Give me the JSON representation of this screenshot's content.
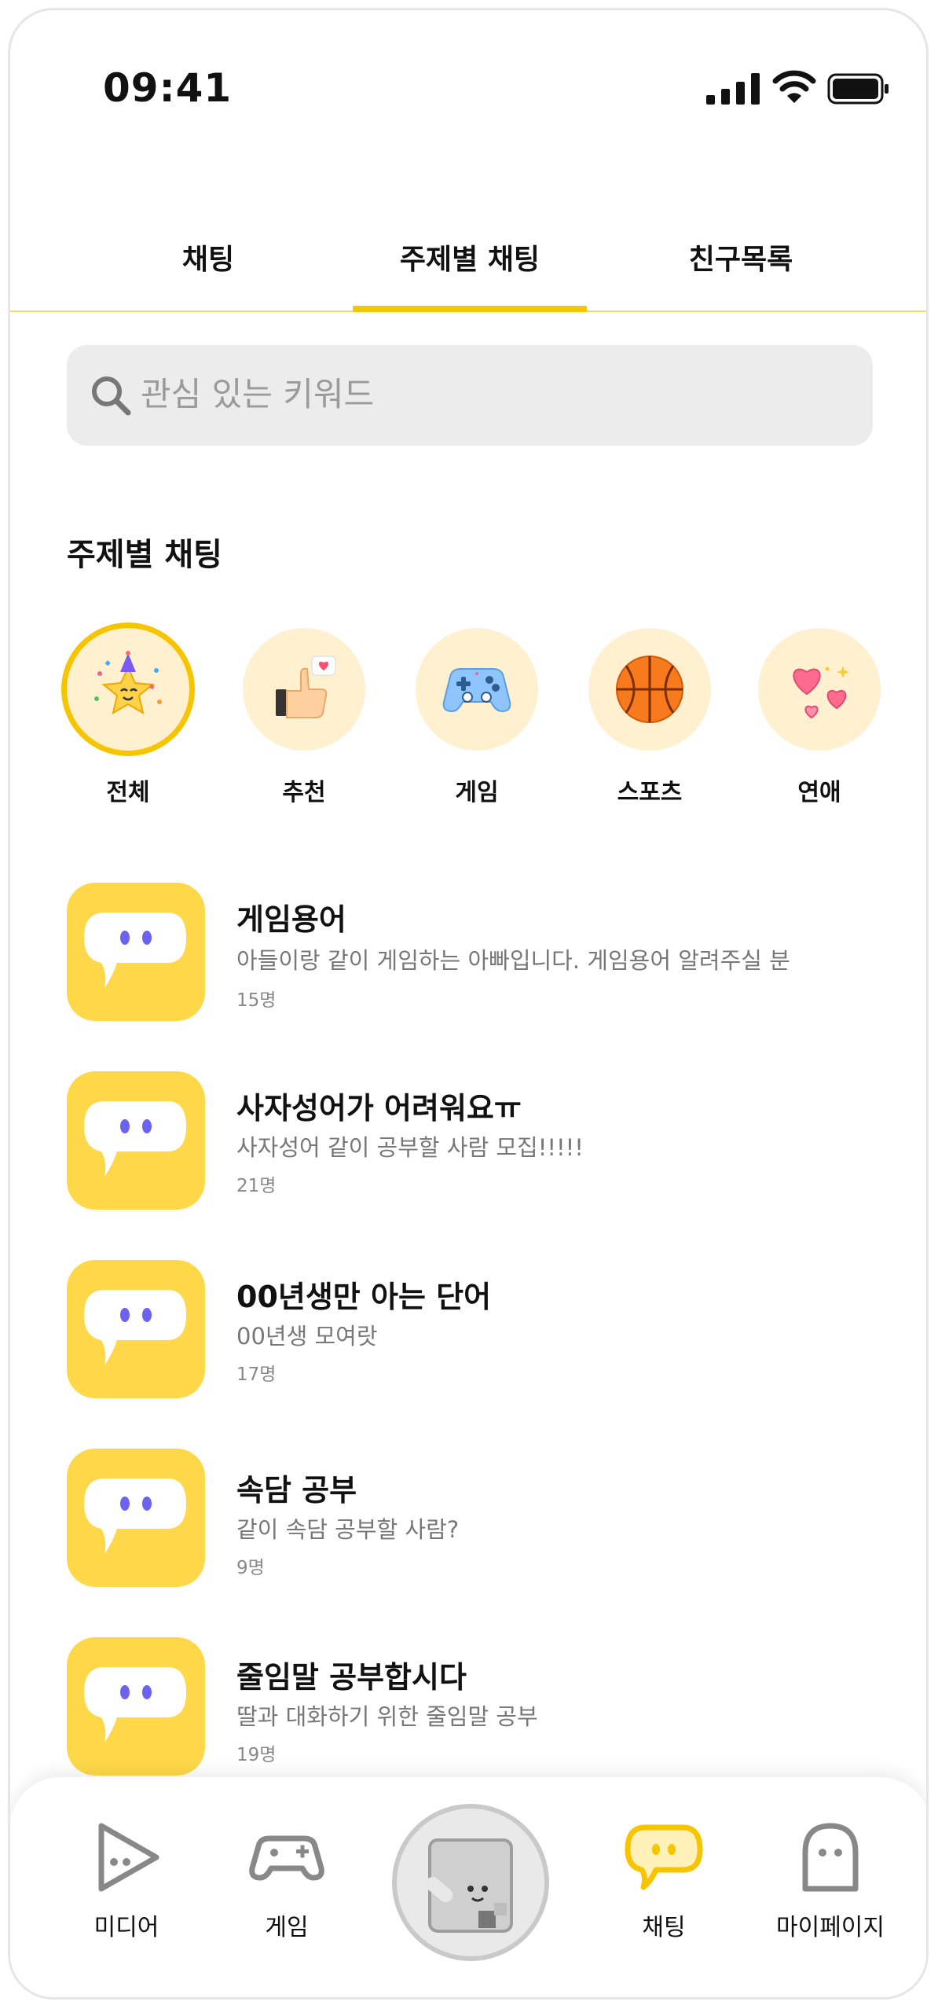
{
  "status_bar": {
    "time": "09:41"
  },
  "tabs": [
    {
      "label": "채팅",
      "active": false
    },
    {
      "label": "주제별 채팅",
      "active": true
    },
    {
      "label": "친구목록",
      "active": false
    }
  ],
  "search": {
    "placeholder": "관심 있는 키워드"
  },
  "section": {
    "title": "주제별 채팅"
  },
  "categories": [
    {
      "label": "전체",
      "icon": "party-star-icon",
      "active": true
    },
    {
      "label": "추천",
      "icon": "thumbs-up-icon",
      "active": false
    },
    {
      "label": "게임",
      "icon": "gamepad-icon",
      "active": false
    },
    {
      "label": "스포츠",
      "icon": "basketball-icon",
      "active": false
    },
    {
      "label": "연애",
      "icon": "hearts-icon",
      "active": false
    }
  ],
  "rooms": [
    {
      "title": "게임용어",
      "desc": "아들이랑 같이 게임하는 아빠입니다. 게임용어 알려주실 분",
      "count": "15명"
    },
    {
      "title": "사자성어가 어려워요ㅠ",
      "desc": "사자성어 같이 공부할 사람 모집!!!!!",
      "count": "21명"
    },
    {
      "title": "00년생만 아는 단어",
      "desc": "00년생 모여랏",
      "count": "17명"
    },
    {
      "title": "속담 공부",
      "desc": "같이 속담 공부할 사람?",
      "count": "9명"
    },
    {
      "title": "줄임말 공부합시다",
      "desc": "딸과 대화하기 위한 줄임말 공부",
      "count": "19명"
    }
  ],
  "bottom_nav": [
    {
      "label": "미디어",
      "icon": "play-icon",
      "active": false
    },
    {
      "label": "게임",
      "icon": "gamepad-outline-icon",
      "active": false
    },
    {
      "label": "",
      "icon": "character-avatar-icon",
      "active": false
    },
    {
      "label": "채팅",
      "icon": "chat-bubble-icon",
      "active": true
    },
    {
      "label": "마이페이지",
      "icon": "ghost-profile-icon",
      "active": false
    }
  ],
  "colors": {
    "accent": "#f7c400",
    "thumb_yellow": "#ffd84a",
    "category_bg": "#fff1cf",
    "dot_purple": "#6b63f0"
  }
}
